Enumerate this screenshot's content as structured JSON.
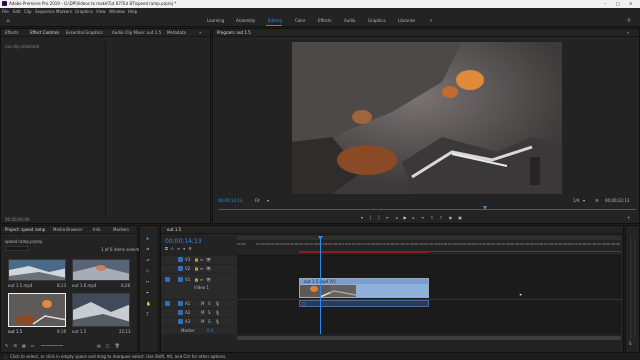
{
  "app": {
    "title": "Adobe Premiere Pro 2019 - G:\\DP\\Videos to make\\Tut 87\\Tut 87\\speed ramp.prproj *",
    "window_controls": [
      "–",
      "□",
      "✕"
    ]
  },
  "menu": [
    "File",
    "Edit",
    "Clip",
    "Sequence",
    "Markers",
    "Graphics",
    "View",
    "Window",
    "Help"
  ],
  "workspaces": [
    "Learning",
    "Assembly",
    "Editing",
    "Color",
    "Effects",
    "Audio",
    "Graphics",
    "Libraries"
  ],
  "workspace_active": "Editing",
  "source_panel": {
    "tabs": [
      "Effects",
      "Effect Controls",
      "Essential Graphics",
      "Audio Clip Mixer: out 1.5",
      "Metadata"
    ],
    "active_tab": "Effect Controls",
    "no_clip": "(no clip selected)",
    "timecode": "00;00;00;00"
  },
  "program": {
    "title": "Program: out 1.5",
    "timecode": "00;00;14;13",
    "fit": "Fit",
    "quality": "1/4",
    "duration": "00;00;22;13"
  },
  "project": {
    "tabs": [
      "Project: speed ramp",
      "Media Browser",
      "Info",
      "Markers"
    ],
    "file": "speed ramp.prproj",
    "selection": "1 of 6 items selected",
    "items": [
      {
        "name": "out 1.5.mp4",
        "duration": "8;13"
      },
      {
        "name": "out 1.6.mp4",
        "duration": "6;28"
      },
      {
        "name": "out 1.5",
        "duration": "9;16"
      },
      {
        "name": "out 1.5",
        "duration": "22;13"
      }
    ]
  },
  "timeline": {
    "tab": "out 1.5",
    "timecode": "00;00;14;13",
    "ruler": [
      "00;00",
      "00;00;02;00",
      "00;00;04;00",
      "00;00;06;00",
      "00;00;08;00",
      "00;00;10;00",
      "00;00;12;00",
      "00;00;14;00",
      "00;00;16;00",
      "00;00;18;00",
      "00;00;20;00",
      "00;00;22;00",
      "00;00;24;00",
      "00;00;26;00",
      "00;00;28;00",
      "00;00;30;00",
      "00;00;32;00",
      "00;00;34;00",
      "00;00;36;00",
      "00;00;38;00"
    ],
    "clip_label": "out 1.5.mp4 [V]",
    "tracks": [
      "V3",
      "V2",
      "V1",
      "A1",
      "A2",
      "A3"
    ],
    "video_label": "Video 1",
    "master": "Master",
    "master_value": "0.0"
  },
  "status": {
    "text": "Click to select, or click in empty space and drag to marquee select. Use Shift, Alt, and Ctrl for other options."
  }
}
